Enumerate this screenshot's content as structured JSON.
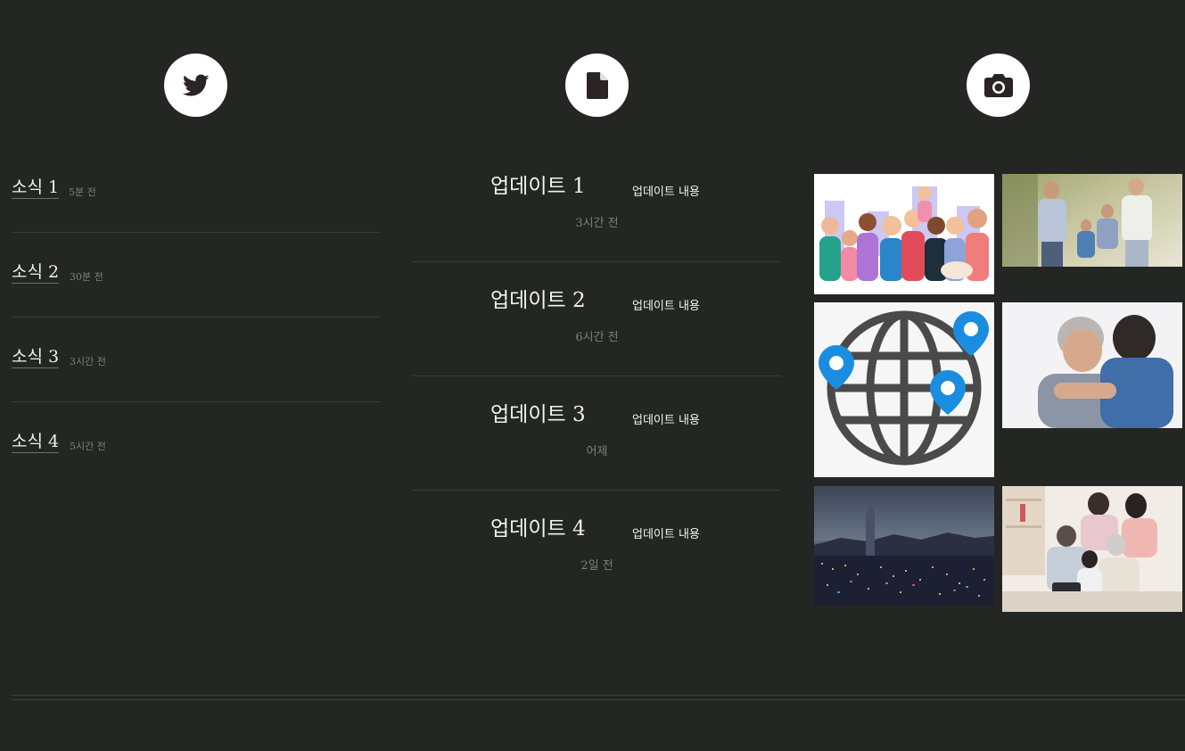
{
  "icons": {
    "left": "twitter-icon",
    "middle": "document-icon",
    "right": "camera-icon"
  },
  "news": [
    {
      "title": "소식 1",
      "time": "5분 전"
    },
    {
      "title": "소식 2",
      "time": "30분 전"
    },
    {
      "title": "소식 3",
      "time": "3시간 전"
    },
    {
      "title": "소식 4",
      "time": "5시간 전"
    }
  ],
  "updates": [
    {
      "title": "업데이트 1",
      "content": "업데이트 내용",
      "time": "3시간 전"
    },
    {
      "title": "업데이트 2",
      "content": "업데이트 내용",
      "time": "6시간 전"
    },
    {
      "title": "업데이트 3",
      "content": "업데이트 내용",
      "time": "어제"
    },
    {
      "title": "업데이트 4",
      "content": "업데이트 내용",
      "time": "2일 전"
    }
  ],
  "gallery": [
    {
      "name": "family-illustration-image"
    },
    {
      "name": "family-walking-photo"
    },
    {
      "name": "globe-location-icon-image"
    },
    {
      "name": "elderly-hug-photo"
    },
    {
      "name": "city-night-skyline-photo"
    },
    {
      "name": "family-tablet-photo"
    }
  ],
  "colors": {
    "background": "#232622",
    "text": "#f2f2ee",
    "muted": "#7d807b",
    "divider": "#3a3e39"
  }
}
